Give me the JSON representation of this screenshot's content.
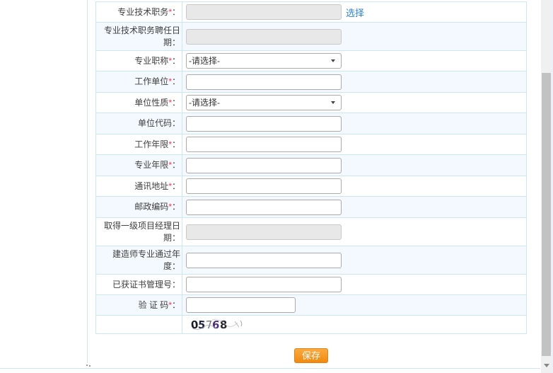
{
  "ui": {
    "required_mark": "*",
    "colon": "：",
    "choose_link": "选择",
    "select_placeholder": "-请选择-",
    "save_label": "保存"
  },
  "form": {
    "rows": [
      {
        "label": "专业技术职务",
        "required": true,
        "type": "disabled-with-link"
      },
      {
        "label": "专业技术职务聘任日期",
        "required": false,
        "type": "disabled"
      },
      {
        "label": "专业职称",
        "required": true,
        "type": "select",
        "value": "-请选择-"
      },
      {
        "label": "工作单位",
        "required": true,
        "type": "text",
        "value": ""
      },
      {
        "label": "单位性质",
        "required": true,
        "type": "select",
        "value": "-请选择-"
      },
      {
        "label": "单位代码",
        "required": false,
        "type": "text",
        "value": ""
      },
      {
        "label": "工作年限",
        "required": true,
        "type": "text",
        "value": ""
      },
      {
        "label": "专业年限",
        "required": true,
        "type": "text",
        "value": ""
      },
      {
        "label": "通讯地址",
        "required": true,
        "type": "text",
        "value": ""
      },
      {
        "label": "邮政编码",
        "required": true,
        "type": "text",
        "value": ""
      },
      {
        "label": "取得一级项目经理日期",
        "required": false,
        "type": "disabled"
      },
      {
        "label": "建造师专业通过年度",
        "required": false,
        "type": "text",
        "value": ""
      },
      {
        "label": "已获证书管理号",
        "required": false,
        "type": "text",
        "value": ""
      },
      {
        "label": "验 证 码",
        "required": true,
        "type": "text-short",
        "value": ""
      }
    ]
  },
  "captcha": {
    "text": "05768",
    "digits": [
      "0",
      "5",
      "7",
      "6",
      "8"
    ]
  }
}
